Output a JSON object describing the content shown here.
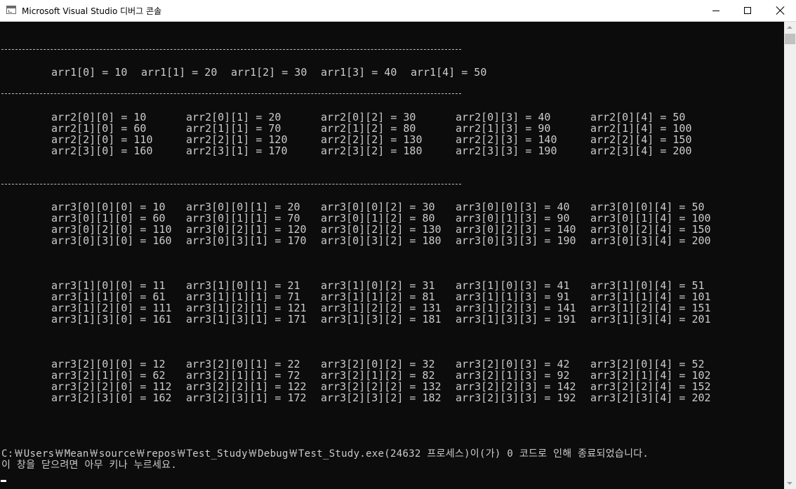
{
  "window": {
    "title": "Microsoft Visual Studio 디버그 콘솔"
  },
  "console": {
    "arr1": [
      "arr1[0] = 10",
      "arr1[1] = 20",
      "arr1[2] = 30",
      "arr1[3] = 40",
      "arr1[4] = 50"
    ],
    "arr2": [
      [
        "arr2[0][0] = 10",
        "arr2[0][1] = 20",
        "arr2[0][2] = 30",
        "arr2[0][3] = 40",
        "arr2[0][4] = 50"
      ],
      [
        "arr2[1][0] = 60",
        "arr2[1][1] = 70",
        "arr2[1][2] = 80",
        "arr2[1][3] = 90",
        "arr2[1][4] = 100"
      ],
      [
        "arr2[2][0] = 110",
        "arr2[2][1] = 120",
        "arr2[2][2] = 130",
        "arr2[2][3] = 140",
        "arr2[2][4] = 150"
      ],
      [
        "arr2[3][0] = 160",
        "arr2[3][1] = 170",
        "arr2[3][2] = 180",
        "arr2[3][3] = 190",
        "arr2[3][4] = 200"
      ]
    ],
    "arr3": [
      [
        [
          "arr3[0][0][0] = 10",
          "arr3[0][0][1] = 20",
          "arr3[0][0][2] = 30",
          "arr3[0][0][3] = 40",
          "arr3[0][0][4] = 50"
        ],
        [
          "arr3[0][1][0] = 60",
          "arr3[0][1][1] = 70",
          "arr3[0][1][2] = 80",
          "arr3[0][1][3] = 90",
          "arr3[0][1][4] = 100"
        ],
        [
          "arr3[0][2][0] = 110",
          "arr3[0][2][1] = 120",
          "arr3[0][2][2] = 130",
          "arr3[0][2][3] = 140",
          "arr3[0][2][4] = 150"
        ],
        [
          "arr3[0][3][0] = 160",
          "arr3[0][3][1] = 170",
          "arr3[0][3][2] = 180",
          "arr3[0][3][3] = 190",
          "arr3[0][3][4] = 200"
        ]
      ],
      [
        [
          "arr3[1][0][0] = 11",
          "arr3[1][0][1] = 21",
          "arr3[1][0][2] = 31",
          "arr3[1][0][3] = 41",
          "arr3[1][0][4] = 51"
        ],
        [
          "arr3[1][1][0] = 61",
          "arr3[1][1][1] = 71",
          "arr3[1][1][2] = 81",
          "arr3[1][1][3] = 91",
          "arr3[1][1][4] = 101"
        ],
        [
          "arr3[1][2][0] = 111",
          "arr3[1][2][1] = 121",
          "arr3[1][2][2] = 131",
          "arr3[1][2][3] = 141",
          "arr3[1][2][4] = 151"
        ],
        [
          "arr3[1][3][0] = 161",
          "arr3[1][3][1] = 171",
          "arr3[1][3][2] = 181",
          "arr3[1][3][3] = 191",
          "arr3[1][3][4] = 201"
        ]
      ],
      [
        [
          "arr3[2][0][0] = 12",
          "arr3[2][0][1] = 22",
          "arr3[2][0][2] = 32",
          "arr3[2][0][3] = 42",
          "arr3[2][0][4] = 52"
        ],
        [
          "arr3[2][1][0] = 62",
          "arr3[2][1][1] = 72",
          "arr3[2][1][2] = 82",
          "arr3[2][1][3] = 92",
          "arr3[2][1][4] = 102"
        ],
        [
          "arr3[2][2][0] = 112",
          "arr3[2][2][1] = 122",
          "arr3[2][2][2] = 132",
          "arr3[2][2][3] = 142",
          "arr3[2][2][4] = 152"
        ],
        [
          "arr3[2][3][0] = 162",
          "arr3[2][3][1] = 172",
          "arr3[2][3][2] = 182",
          "arr3[2][3][3] = 192",
          "arr3[2][3][4] = 202"
        ]
      ]
    ],
    "exit_message": "C:￦Users￦Mean￦source￦repos￦Test_Study￦Debug￦Test_Study.exe(24632 프로세스)이(가) 0 코드로 인해 종료되었습니다.",
    "prompt_message": "이 창을 닫으려면 아무 키나 누르세요."
  }
}
